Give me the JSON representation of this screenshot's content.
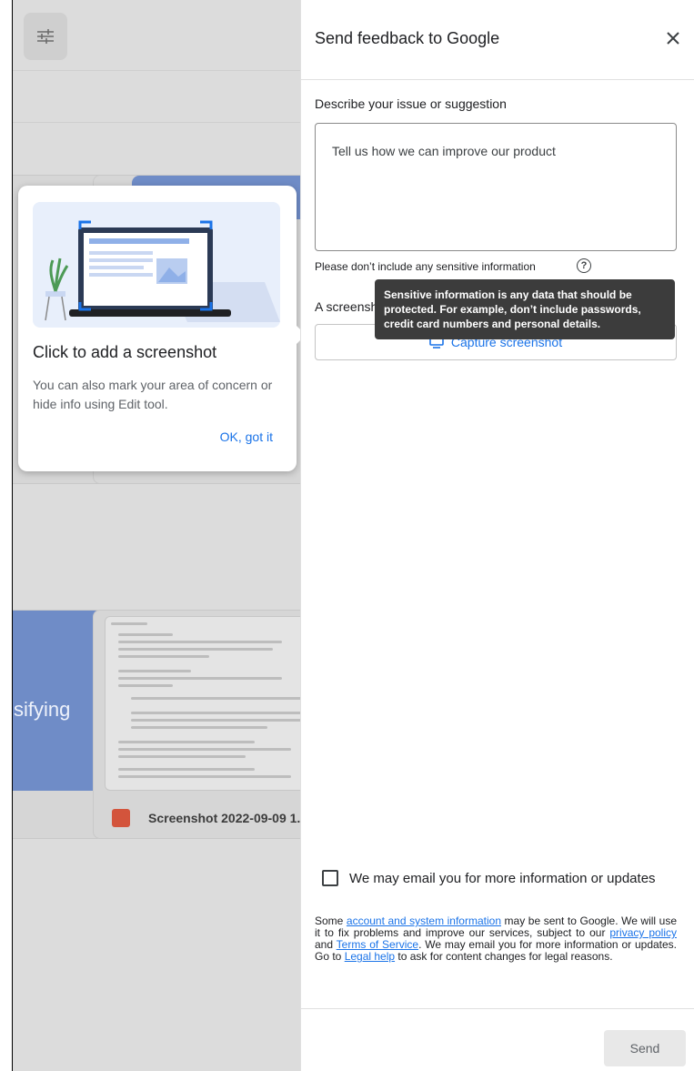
{
  "background": {
    "partial_word": "sifying",
    "file_label": "Screenshot 2022-09-09 1..."
  },
  "callout": {
    "title": "Click to add a screenshot",
    "body": "You can also mark your area of concern or hide info using Edit tool.",
    "ok_label": "OK, got it"
  },
  "panel": {
    "title": "Send feedback to Google",
    "describe_label": "Describe your issue or suggestion",
    "textarea_placeholder": "Tell us how we can improve our product",
    "sensitive_note": "Please don’t include any sensitive information",
    "screenshot_label": "A screenshot will help us better understand the issue.",
    "capture_label": "Capture screenshot",
    "tooltip": "Sensitive information is any data that should be protected. For example, don’t include passwords, credit card numbers and personal details.",
    "email_checkbox_label": "We may email you for more information or updates",
    "legal": {
      "part1": "Some ",
      "link1": "account and system information",
      "part2": " may be sent to Google. We will use it to fix problems and improve our services, subject to our ",
      "link2": "privacy policy",
      "part3": " and ",
      "link3": "Terms of Service",
      "part4": ". We may email you for more information or updates. Go to ",
      "link4": "Legal help",
      "part5": " to ask for content changes for legal reasons."
    },
    "send_label": "Send"
  },
  "colors": {
    "accent": "#1a73e8",
    "tooltip_bg": "#3c3c3c",
    "overlay_bg": "#dcdcdc"
  }
}
